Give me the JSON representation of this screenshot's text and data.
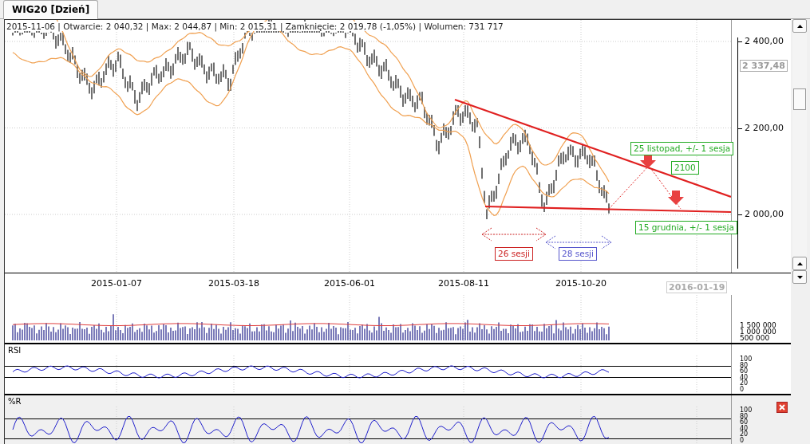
{
  "tab": {
    "label": "WIG20 [Dzień]",
    "selected": true
  },
  "price_panel": {
    "info": "2015-11-06 | Otwarcie: 2 040,32 | Max: 2 044,87 | Min: 2 015,31 | Zamknięcie: 2 019,78 (-1,05%) | Wolumen: 731 717",
    "y_ticks": [
      "2 400,00",
      "2 200,00",
      "2 000,00"
    ],
    "current_price": "2 337,48",
    "annotations": [
      {
        "kind": "label",
        "text": "25 listopad, +/- 1 sesja",
        "color": "#22aa22"
      },
      {
        "kind": "label",
        "text": "2100",
        "color": "#22aa22"
      },
      {
        "kind": "label",
        "text": "15 grudnia, +/- 1 sesja",
        "color": "#22aa22"
      },
      {
        "kind": "span",
        "text": "26 sesji",
        "color": "#cc2222"
      },
      {
        "kind": "span",
        "text": "28 sesji",
        "color": "#5555cc"
      }
    ]
  },
  "date_axis": {
    "labels": [
      "2015-01-07",
      "2015-03-18",
      "2015-06-01",
      "2015-08-11",
      "2015-10-20"
    ],
    "cursor_date": "2016-01-19"
  },
  "volume_panel": {
    "y_ticks": [
      "1 500 000",
      "1 000 000",
      "500 000"
    ]
  },
  "rsi_panel": {
    "title": "RSI",
    "y_ticks": [
      "100",
      "80",
      "60",
      "40",
      "20",
      "0"
    ]
  },
  "williams_panel": {
    "title": "%R",
    "y_ticks": [
      "100",
      "80",
      "60",
      "40",
      "20",
      "0"
    ]
  }
}
